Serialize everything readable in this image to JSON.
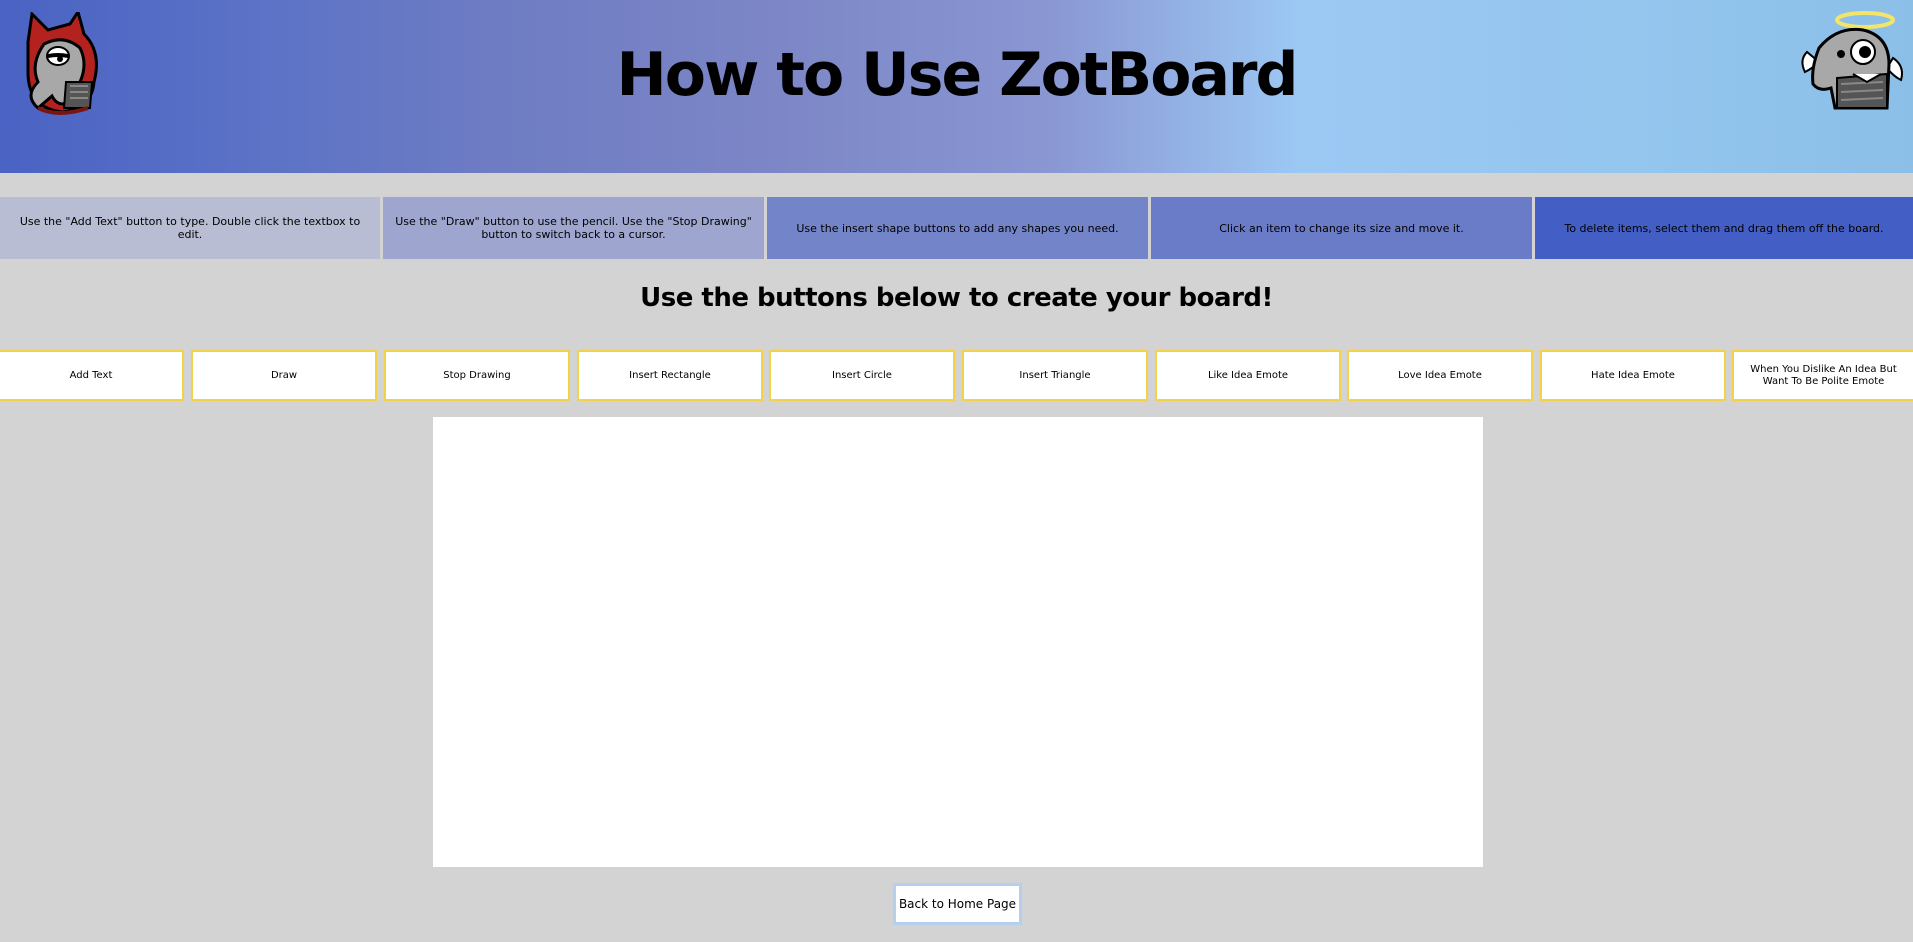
{
  "header": {
    "title": "How to Use ZotBoard",
    "left_mascot_icon": "devil-anteater-icon",
    "right_mascot_icon": "angel-anteater-icon"
  },
  "instructions": [
    {
      "text": "Use the \"Add Text\" button to type. Double click the textbox to edit.",
      "color": "#b9bdd3"
    },
    {
      "text": "Use the \"Draw\" button to use the pencil. Use the \"Stop Drawing\" button to switch back to a cursor.",
      "color": "#9ea6cf"
    },
    {
      "text": "Use the insert shape buttons to add any shapes you need.",
      "color": "#7384c9"
    },
    {
      "text": "Click an item to change its size and move it.",
      "color": "#6a7bc7"
    },
    {
      "text": "To delete items, select them and drag them off the board.",
      "color": "#435fc5"
    }
  ],
  "subheading": "Use the buttons below to create your board!",
  "toolbar": {
    "buttons": [
      "Add Text",
      "Draw",
      "Stop Drawing",
      "Insert Rectangle",
      "Insert Circle",
      "Insert Triangle",
      "Like Idea Emote",
      "Love Idea Emote",
      "Hate Idea Emote",
      "When You Dislike An Idea But Want To Be Polite Emote"
    ]
  },
  "footer": {
    "home_label": "Back to Home Page"
  }
}
